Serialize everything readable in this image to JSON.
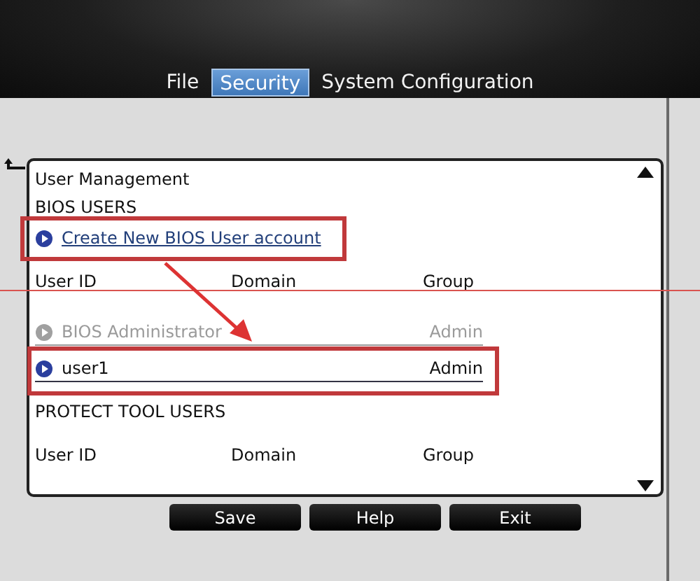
{
  "tabs": [
    {
      "label": "File",
      "selected": false
    },
    {
      "label": "Security",
      "selected": true
    },
    {
      "label": "System Configuration",
      "selected": false
    }
  ],
  "panel": {
    "title": "User Management",
    "sections": [
      {
        "heading": "BIOS USERS",
        "link": "Create New BIOS User account",
        "columns": [
          "User ID",
          "Domain",
          "Group"
        ],
        "users": [
          {
            "user_id": "BIOS Administrator",
            "group": "Admin",
            "disabled": true
          },
          {
            "user_id": "user1",
            "group": "Admin",
            "disabled": false
          }
        ]
      },
      {
        "heading": "PROTECT TOOL USERS",
        "columns": [
          "User ID",
          "Domain",
          "Group"
        ]
      }
    ]
  },
  "buttons": [
    "Save",
    "Help",
    "Exit"
  ]
}
